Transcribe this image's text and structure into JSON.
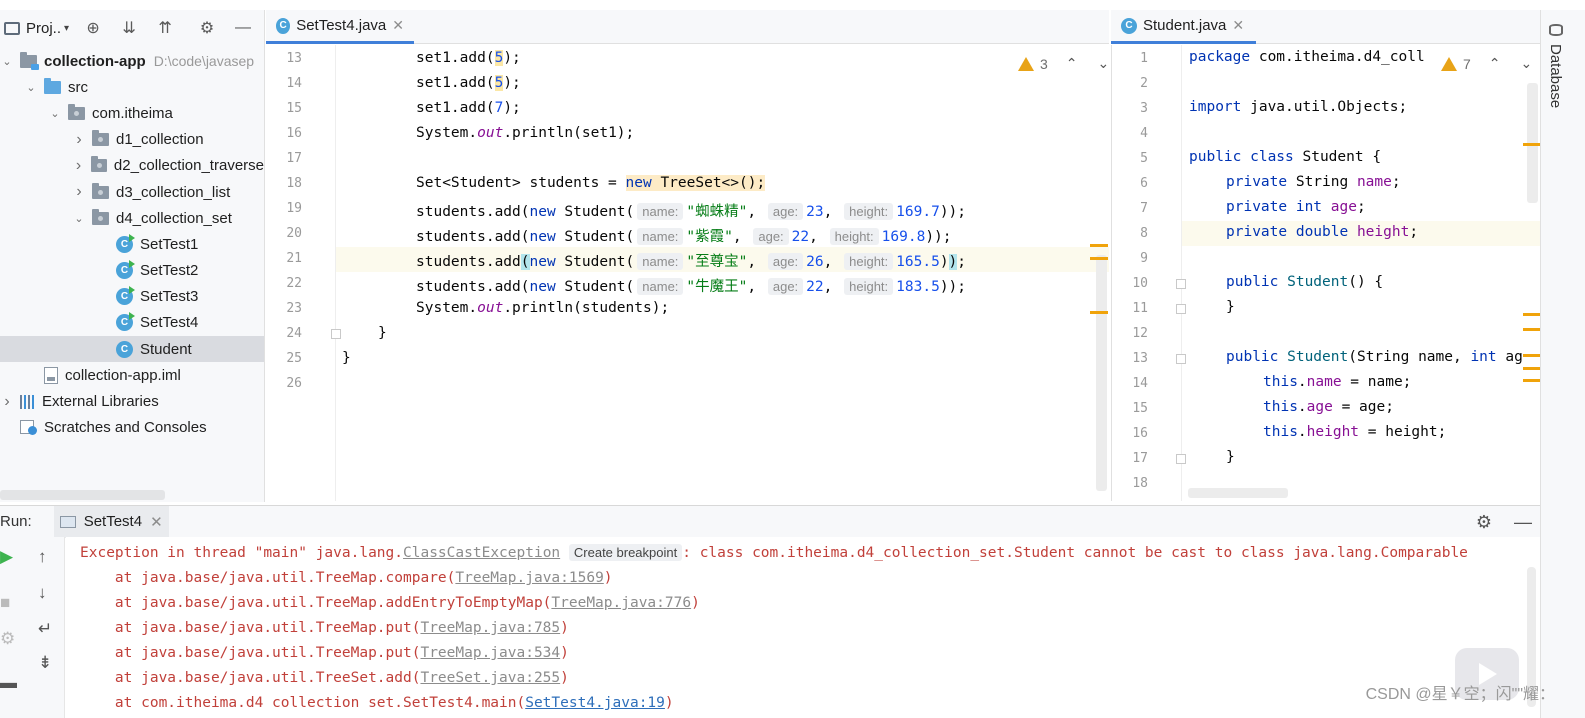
{
  "project": {
    "title": "Proj..",
    "tree": [
      {
        "label": "collection-app",
        "hint": "D:\\code\\javasep",
        "kind": "module",
        "level": 0,
        "arrow": "open"
      },
      {
        "label": "src",
        "kind": "src",
        "level": 1,
        "arrow": "open"
      },
      {
        "label": "com.itheima",
        "kind": "pkg",
        "level": 2,
        "arrow": "open"
      },
      {
        "label": "d1_collection",
        "kind": "pkg",
        "level": 3,
        "arrow": "closed"
      },
      {
        "label": "d2_collection_traverse",
        "kind": "pkg",
        "level": 3,
        "arrow": "closed"
      },
      {
        "label": "d3_collection_list",
        "kind": "pkg",
        "level": 3,
        "arrow": "closed"
      },
      {
        "label": "d4_collection_set",
        "kind": "pkg",
        "level": 3,
        "arrow": "open"
      },
      {
        "label": "SetTest1",
        "kind": "runclass",
        "level": 4
      },
      {
        "label": "SetTest2",
        "kind": "runclass",
        "level": 4
      },
      {
        "label": "SetTest3",
        "kind": "runclass",
        "level": 4
      },
      {
        "label": "SetTest4",
        "kind": "runclass",
        "level": 4
      },
      {
        "label": "Student",
        "kind": "class",
        "level": 4,
        "selected": true
      },
      {
        "label": "collection-app.iml",
        "kind": "file",
        "level": 1
      },
      {
        "label": "External Libraries",
        "kind": "lib",
        "level": 0,
        "arrow": "closed"
      },
      {
        "label": "Scratches and Consoles",
        "kind": "scratch",
        "level": 0
      }
    ]
  },
  "editor1": {
    "tab": "SetTest4.java",
    "warnings": "3",
    "line_numbers": [
      "13",
      "14",
      "15",
      "16",
      "17",
      "18",
      "19",
      "20",
      "21",
      "22",
      "23",
      "24",
      "25",
      "26"
    ]
  },
  "editor2": {
    "tab": "Student.java",
    "warnings": "7",
    "line_numbers": [
      "1",
      "2",
      "3",
      "4",
      "5",
      "6",
      "7",
      "8",
      "9",
      "10",
      "11",
      "12",
      "13",
      "14",
      "15",
      "16",
      "17",
      "18"
    ]
  },
  "code1": {
    "l13": [
      "set1.add(",
      "5",
      ");"
    ],
    "l14": [
      "set1.add(",
      "5",
      ");"
    ],
    "l15": [
      "set1.add(",
      "7",
      ");"
    ],
    "l16": [
      "System.",
      "out",
      ".println(set1);"
    ],
    "l18": [
      "Set<Student> students = ",
      "new",
      " TreeSet<>();"
    ],
    "students_add": "students.add(",
    "new_kw": "new",
    "student_ctor": " Student(",
    "hint_name": "name:",
    "hint_age": "age:",
    "hint_height": "height:",
    "rows": [
      {
        "name": "\"蜘蛛精\"",
        "age": "23",
        "height": "169.7"
      },
      {
        "name": "\"紫霞\"",
        "age": "22",
        "height": "169.8"
      },
      {
        "name": "\"至尊宝\"",
        "age": "26",
        "height": "165.5"
      },
      {
        "name": "\"牛魔王\"",
        "age": "22",
        "height": "183.5"
      }
    ],
    "close_paren": "));",
    "l23": [
      "System.",
      "out",
      ".println(students);"
    ],
    "l24": "}",
    "l25": "}"
  },
  "code2": {
    "l1": [
      "package",
      " com.itheima.d4_coll"
    ],
    "l3": [
      "import",
      " java.util.Objects;"
    ],
    "l5": [
      "public class",
      " Student {"
    ],
    "l6": [
      "private",
      " String ",
      "name",
      ";"
    ],
    "l7": [
      "private int",
      " ",
      "age",
      ";"
    ],
    "l8": [
      "private double",
      " ",
      "height",
      ";"
    ],
    "l10": [
      "public",
      " Student",
      "() {"
    ],
    "l11": "}",
    "l13": [
      "public",
      " Student",
      "(String name, ",
      "int",
      " ag"
    ],
    "l14": [
      "this",
      ".",
      "name",
      " = name;"
    ],
    "l15": [
      "this",
      ".",
      "age",
      " = age;"
    ],
    "l16": [
      "this",
      ".",
      "height",
      " = height;"
    ],
    "l17": "}"
  },
  "sidebar_right": {
    "label": "Database"
  },
  "run": {
    "label": "Run:",
    "tab": "SetTest4",
    "exception_prefix": "Exception in thread \"main\" java.lang.",
    "exception_class": "ClassCastException",
    "create_breakpoint": "Create breakpoint",
    "exception_msg": ": class com.itheima.d4_collection_set.Student cannot be cast to class java.lang.Comparable",
    "stack": [
      {
        "prefix": "    at java.base/java.util.TreeMap.compare(",
        "link": "TreeMap.java:1569",
        "suffix": ")"
      },
      {
        "prefix": "    at java.base/java.util.TreeMap.addEntryToEmptyMap(",
        "link": "TreeMap.java:776",
        "suffix": ")"
      },
      {
        "prefix": "    at java.base/java.util.TreeMap.put(",
        "link": "TreeMap.java:785",
        "suffix": ")"
      },
      {
        "prefix": "    at java.base/java.util.TreeMap.put(",
        "link": "TreeMap.java:534",
        "suffix": ")"
      },
      {
        "prefix": "    at java.base/java.util.TreeSet.add(",
        "link": "TreeSet.java:255",
        "suffix": ")"
      },
      {
        "prefix": "    at com.itheima.d4 collection set.SetTest4.main(",
        "link": "SetTest4.java:19",
        "suffix": ")"
      }
    ]
  },
  "watermark": "CSDN @星￥空；闪\"\"耀：",
  "colors": {
    "accent": "#3f7fd9",
    "error": "#c1403a",
    "keyword": "#0033b3",
    "string": "#067d17",
    "number": "#1750eb"
  }
}
